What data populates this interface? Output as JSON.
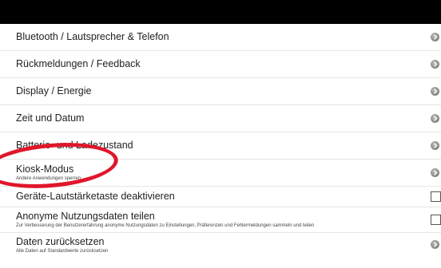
{
  "settings": {
    "items": [
      {
        "label": "Bluetooth / Lautsprecher & Telefon"
      },
      {
        "label": "Rückmeldungen / Feedback"
      },
      {
        "label": "Display / Energie"
      },
      {
        "label": "Zeit und Datum"
      },
      {
        "label": "Batterie- und Ladezustand"
      },
      {
        "label": "Kiosk-Modus",
        "sublabel": "Andere Anwendungen sperren"
      },
      {
        "label": "Geräte-Lautstärketaste deaktivieren"
      },
      {
        "label": "Anonyme Nutzungsdaten teilen",
        "sublabel": "Zur Verbesserung der Benutzererfahrung anonyme Nutzungsdaten zu Einstellungen, Präferenzen und Fehlermeldungen sammeln und teilen"
      },
      {
        "label": "Daten zurücksetzen",
        "sublabel": "Alle Daten auf Standardwerte zurücksetzen"
      }
    ]
  },
  "annotation": {
    "color": "#e0162b"
  },
  "icons": {
    "chevron": "chevron-right-icon",
    "checkbox": "checkbox-unchecked"
  }
}
